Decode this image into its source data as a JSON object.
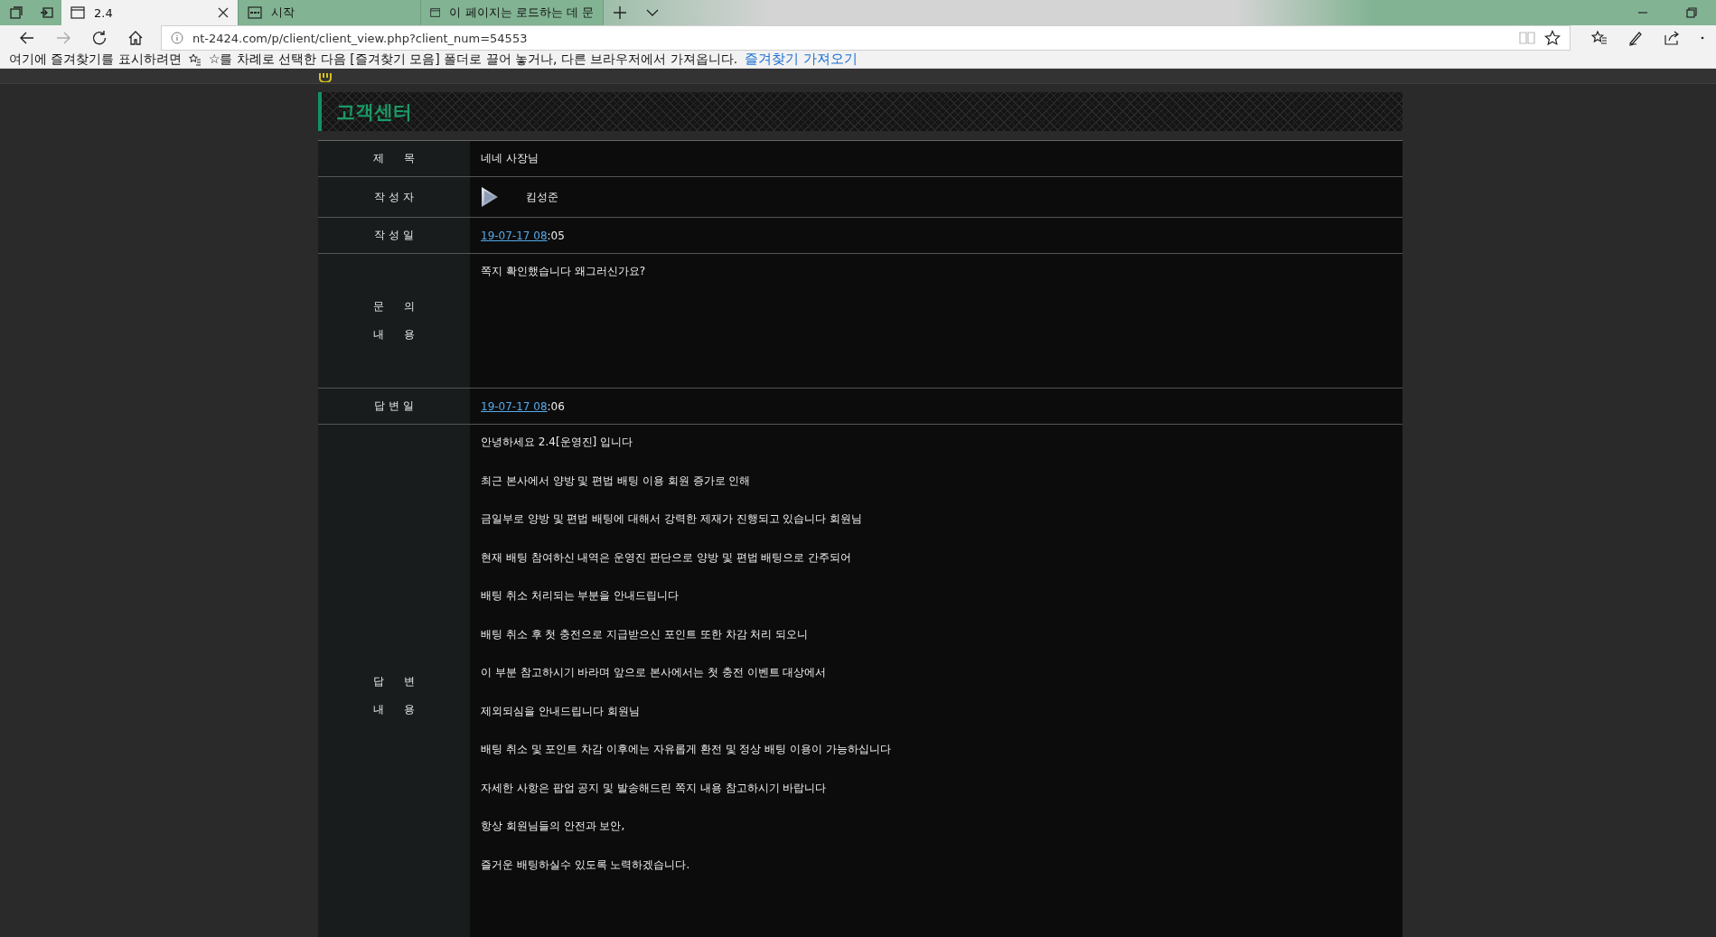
{
  "browser": {
    "tabs": [
      {
        "title": "2.4",
        "selected": true
      },
      {
        "title": "시작",
        "selected": false
      },
      {
        "title": "이 페이지는 로드하는 데 문",
        "selected": false
      }
    ],
    "address": "nt-2424.com/p/client/client_view.php?client_num=54553",
    "favorites_bar": {
      "message": "여기에 즐겨찾기를 표시하려면",
      "message2": "☆를 차례로 선택한 다음 [즐겨찾기 모음] 폴더로 끌어 놓거나, 다른 브라우저에서 가져옵니다.",
      "link": "즐겨찾기 가져오기"
    }
  },
  "page": {
    "section_title": "고객센터",
    "rows": [
      {
        "kind": "text",
        "label": [
          "제      목"
        ],
        "value": "네네 사장님"
      },
      {
        "kind": "author",
        "label": [
          "작 성 자"
        ],
        "value": "킴성준"
      },
      {
        "kind": "date",
        "label": [
          "작 성 일"
        ],
        "date_link": "19-07-17 08",
        "date_rest": ":05"
      },
      {
        "kind": "body",
        "label": [
          "문      의",
          "내      용"
        ],
        "lines": [
          "쪽지 확인했습니다 왜그러신가요?"
        ]
      },
      {
        "kind": "date",
        "label": [
          "답 변 일"
        ],
        "date_link": "19-07-17 08",
        "date_rest": ":06"
      },
      {
        "kind": "answer",
        "label": [
          "답      변",
          "내      용"
        ],
        "lines": [
          "안녕하세요 2.4[운영진] 입니다",
          "최근 본사에서 양방 및 편법 배팅 이용 회원 증가로 인해",
          "금일부로 양방 및 편법 배팅에 대해서 강력한 제재가 진행되고 있습니다 회원님",
          "현재 배팅 참여하신 내역은 운영진 판단으로 양방 및 편법 배팅으로 간주되어",
          "배팅 취소 처리되는 부분을 안내드립니다",
          "배팅 취소 후 첫 충전으로 지급받으신 포인트 또한 차감 처리 되오니",
          "이 부분 참고하시기 바라며 앞으로 본사에서는 첫 충전 이벤트 대상에서",
          "제외되심을 안내드립니다 회원님",
          "배팅 취소 및 포인트 차감 이후에는 자유롭게 환전 및 정상 배팅 이용이 가능하십니다",
          "자세한 사항은 팝업 공지 및 발송해드린 쪽지 내용 참고하시기 바랍니다",
          "항상 회원님들의 안전과 보안,",
          "즐거운 배팅하실수 있도록 노력하겠습니다."
        ]
      }
    ]
  }
}
